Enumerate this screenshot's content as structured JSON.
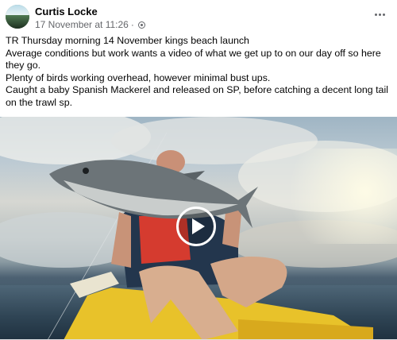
{
  "post": {
    "author": "Curtis Locke",
    "timestamp": "17 November at 11:26",
    "separator": "·",
    "audience_icon": "globe-icon",
    "more_icon": "more-horizontal-icon",
    "text_lines": [
      "TR Thursday morning 14 November kings beach launch",
      "Average conditions but work wants a video of what we get up to on our day off so here they go.",
      "Plenty of birds working overhead, however minimal bust ups.",
      "Caught a baby Spanish Mackerel and released on SP, before catching a decent long tail on the trawl sp."
    ],
    "video": {
      "play_icon": "play-icon"
    }
  }
}
